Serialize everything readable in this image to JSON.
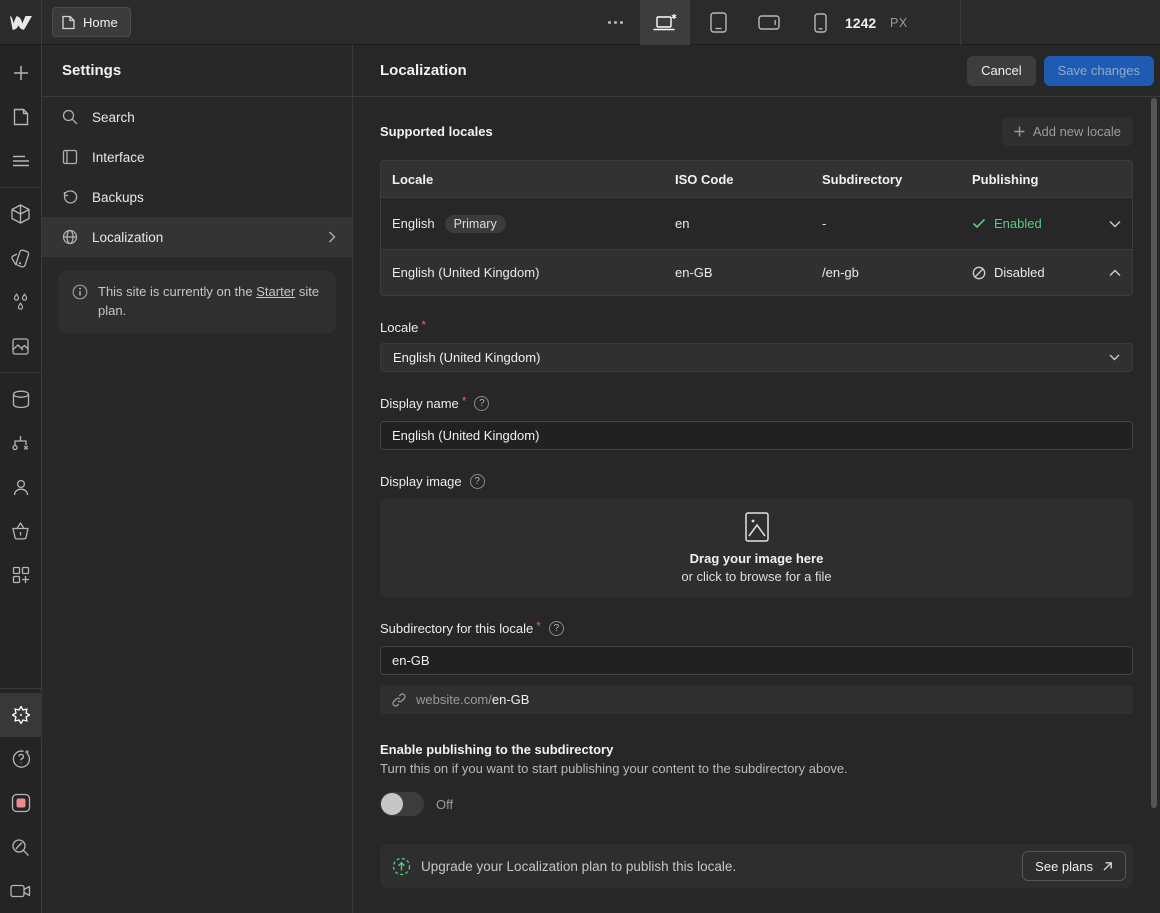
{
  "topbar": {
    "home_label": "Home",
    "breakpoint_value": "1242",
    "breakpoint_unit": "PX"
  },
  "sidebar_icon_names": [
    "add",
    "pages",
    "navigator",
    "components",
    "style-panel",
    "variables",
    "assets",
    "cms",
    "logic",
    "users",
    "ecommerce",
    "apps",
    "settings",
    "help",
    "record",
    "zoom",
    "video"
  ],
  "settings_panel": {
    "title": "Settings",
    "items": [
      {
        "label": "Search"
      },
      {
        "label": "Interface"
      },
      {
        "label": "Backups"
      },
      {
        "label": "Localization"
      }
    ],
    "notice_before": "This site is currently on the ",
    "notice_link": "Starter",
    "notice_after": " site plan."
  },
  "header": {
    "title": "Localization",
    "cancel_label": "Cancel",
    "save_label": "Save changes"
  },
  "locales": {
    "section_title": "Supported locales",
    "add_button_label": "Add new locale",
    "headers": [
      "Locale",
      "ISO Code",
      "Subdirectory",
      "Publishing"
    ],
    "rows": [
      {
        "locale": "English",
        "badge": "Primary",
        "iso": "en",
        "subdirectory": "-",
        "publishing": "Enabled"
      },
      {
        "locale": "English (United Kingdom)",
        "iso": "en-GB",
        "subdirectory": "/en-gb",
        "publishing": "Disabled"
      }
    ]
  },
  "form": {
    "required_marker": "*",
    "help_glyph": "?",
    "locale_label": "Locale",
    "locale_value": "English (United Kingdom)",
    "display_name_label": "Display name",
    "display_name_value": "English (United Kingdom)",
    "display_image_label": "Display image",
    "dropzone_line1": "Drag your image here",
    "dropzone_line2": "or click to browse for a file",
    "subdirectory_label": "Subdirectory for this locale",
    "subdirectory_value": "en-GB",
    "url_preview_prefix": "website.com/",
    "url_preview_value": "en-GB",
    "publish_title": "Enable publishing to the subdirectory",
    "publish_description": "Turn this on if you want to start publishing your content to the subdirectory above.",
    "toggle_label": "Off",
    "upgrade_message": "Upgrade your Localization plan to publish this locale.",
    "see_plans_label": "See plans"
  },
  "colors": {
    "accent_blue": "#1d5cb2",
    "success_green": "#58cb7e",
    "record_red": "#ee8b8b",
    "required_red": "#e25e67"
  }
}
